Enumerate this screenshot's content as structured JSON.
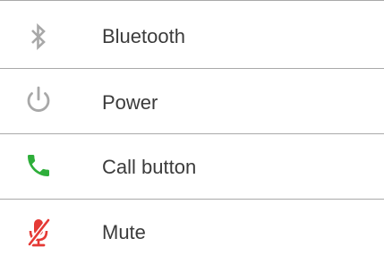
{
  "legend": {
    "items": [
      {
        "label": "Bluetooth",
        "icon": "bluetooth-icon",
        "icon_color": "#a8a8a8"
      },
      {
        "label": "Power",
        "icon": "power-icon",
        "icon_color": "#a8a8a8"
      },
      {
        "label": "Call button",
        "icon": "phone-call-icon",
        "icon_color": "#2eae3a"
      },
      {
        "label": "Mute",
        "icon": "microphone-muted-icon",
        "icon_color": "#e53935"
      }
    ]
  }
}
